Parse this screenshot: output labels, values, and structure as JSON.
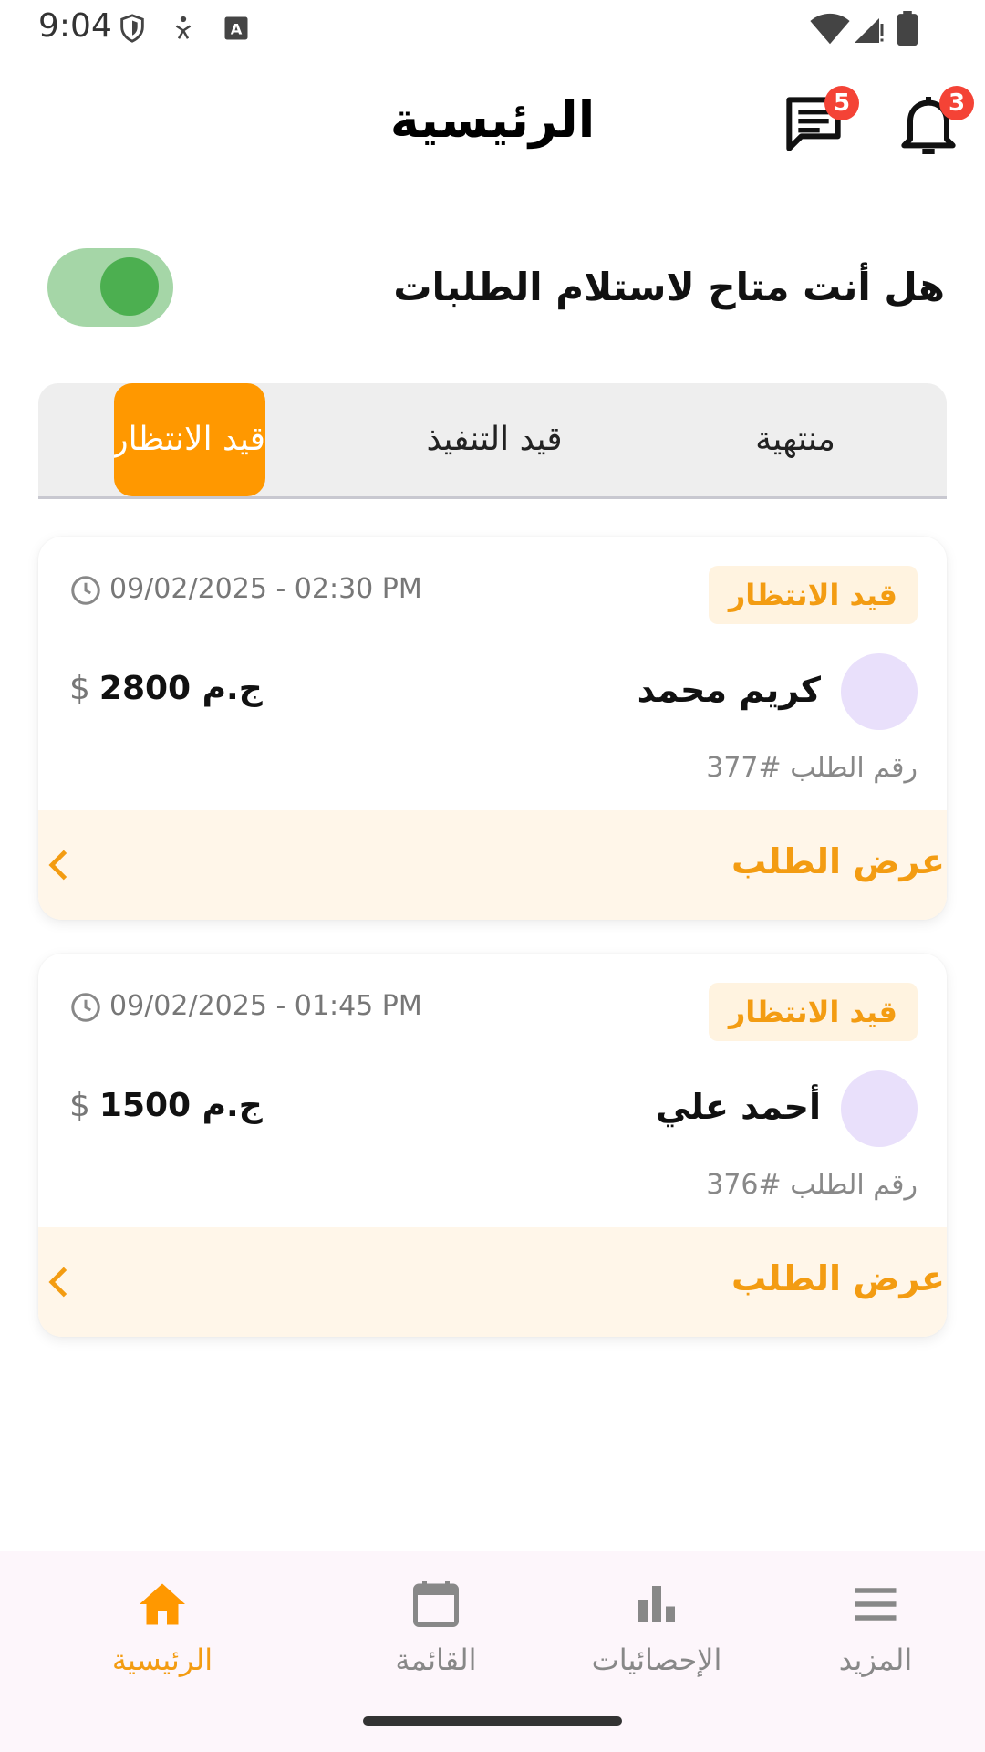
{
  "status_bar": {
    "time": "9:04"
  },
  "header": {
    "title": "الرئيسية",
    "messages_badge": "5",
    "notifications_badge": "3"
  },
  "availability": {
    "label": "هل أنت متاح لاستلام الطلبات",
    "enabled": true
  },
  "tabs": [
    {
      "label": "منتهية",
      "active": false
    },
    {
      "label": "قيد التنفيذ",
      "active": false
    },
    {
      "label": "قيد الانتظار",
      "active": true
    }
  ],
  "orders": [
    {
      "status": "قيد الانتظار",
      "datetime": "09/02/2025 - 02:30 PM",
      "customer": "كريم محمد",
      "price": "2800 ج.م",
      "currency_icon": "$",
      "order_no": "رقم الطلب #377",
      "action": "عرض الطلب"
    },
    {
      "status": "قيد الانتظار",
      "datetime": "09/02/2025 - 01:45 PM",
      "customer": "أحمد علي",
      "price": "1500 ج.م",
      "currency_icon": "$",
      "order_no": "رقم الطلب #376",
      "action": "عرض الطلب"
    }
  ],
  "bottom_nav": [
    {
      "label": "الرئيسية",
      "icon": "home-icon",
      "active": true
    },
    {
      "label": "القائمة",
      "icon": "calendar-icon",
      "active": false
    },
    {
      "label": "الإحصائيات",
      "icon": "bar-chart-icon",
      "active": false
    },
    {
      "label": "المزيد",
      "icon": "menu-icon",
      "active": false
    }
  ],
  "colors": {
    "accent": "#ff9800",
    "accent_text": "#f39c12",
    "toggle_track": "#a5d6a7",
    "toggle_knob": "#4caf50",
    "badge": "#f44336"
  }
}
